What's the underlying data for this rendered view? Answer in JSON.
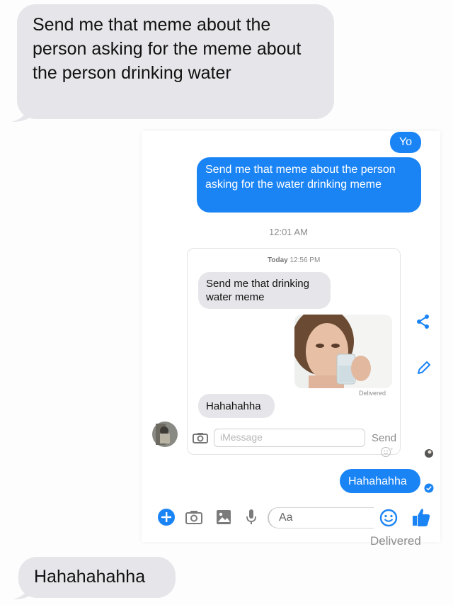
{
  "outer_thread": {
    "top_message": "Send me that meme about the person asking for the meme about the person drinking water",
    "bottom_message": "Hahahahahha"
  },
  "messenger": {
    "yo_message": "Yo",
    "sent_message": "Send me that meme about the person asking for the water drinking meme",
    "timestamp": "12:01 AM",
    "reply_message": "Hahahahha",
    "input_placeholder": "Aa",
    "delivered_label": "Delivered"
  },
  "inner_imessage": {
    "date_label": "Today",
    "time_label": "12:56 PM",
    "request_message": "Send me that drinking water meme",
    "delivered_label": "Delivered",
    "reply_message": "Hahahahha",
    "input_placeholder": "iMessage",
    "send_label": "Send"
  },
  "colors": {
    "messenger_blue": "#1b84f5",
    "bubble_gray": "#e6e6ea"
  },
  "icons": {
    "share": "share-icon",
    "edit": "pencil-icon",
    "add": "plus-icon",
    "camera": "camera-icon",
    "gallery": "image-icon",
    "mic": "microphone-icon",
    "emoji": "smiley-icon",
    "like": "thumbs-up-icon"
  }
}
